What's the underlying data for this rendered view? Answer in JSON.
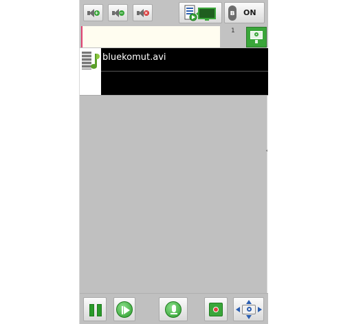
{
  "toolbar": {
    "volume_up_icon": "volume-up-icon",
    "volume_down_icon": "volume-down-icon",
    "mute_icon": "mute-icon",
    "cast_icon": "cast-screen-icon",
    "bluetooth_glyph": "ʙ",
    "bluetooth_label": "ON"
  },
  "track": {
    "number": "1"
  },
  "playlist": {
    "items": [
      {
        "name": "bluekomut.avi",
        "icon": "video-music-icon"
      }
    ]
  },
  "controls": {
    "pause_icon": "pause-icon",
    "next_icon": "next-track-icon",
    "mic_icon": "microphone-icon",
    "record_icon": "record-icon",
    "dpad_icon": "dpad-icon"
  },
  "colors": {
    "accent_green": "#3aa63a",
    "list_bg": "#000000",
    "app_bg": "#c0c0c0"
  }
}
